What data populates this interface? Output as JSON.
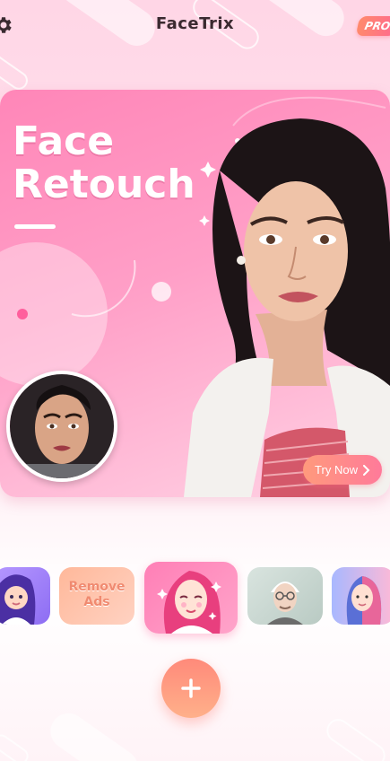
{
  "header": {
    "title": "FaceTrix",
    "pro_label": "PRO",
    "settings_icon": "gear-icon"
  },
  "banner": {
    "title_line1": "Face",
    "title_line2": "Retouch",
    "try_now_label": "Try Now",
    "try_now_icon": "chevron-right-icon"
  },
  "carousel": {
    "items": [
      {
        "name": "avatar-cartoon",
        "label": ""
      },
      {
        "name": "remove-ads",
        "label": "Remove Ads"
      },
      {
        "name": "face-retouch",
        "label": ""
      },
      {
        "name": "old-face",
        "label": ""
      },
      {
        "name": "gender-swap",
        "label": ""
      }
    ]
  },
  "add_icon": "plus-icon",
  "colors": {
    "accent": "#ff86b8",
    "button_orange": "#ff8a7a",
    "title_text": "#3a2a30"
  }
}
